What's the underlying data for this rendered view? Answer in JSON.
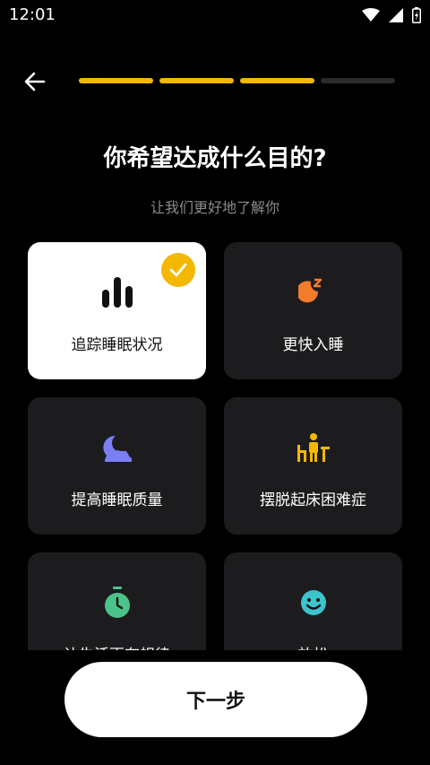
{
  "status_bar": {
    "time": "12:01"
  },
  "progress": {
    "total_steps": 4,
    "completed_steps": 3,
    "accent_color": "#f5b800"
  },
  "header": {
    "title": "你希望达成什么目的?",
    "subtitle": "让我们更好地了解你"
  },
  "options": [
    {
      "label": "追踪睡眠状况",
      "icon": "bar-chart-icon",
      "selected": true
    },
    {
      "label": "更快入睡",
      "icon": "moon-zz-icon",
      "selected": false
    },
    {
      "label": "提高睡眠质量",
      "icon": "moon-cloud-icon",
      "selected": false
    },
    {
      "label": "摆脱起床困难症",
      "icon": "person-desk-icon",
      "selected": false
    },
    {
      "label": "让生活更有规律",
      "icon": "stopwatch-icon",
      "selected": false
    },
    {
      "label": "放松",
      "icon": "smile-icon",
      "selected": false
    }
  ],
  "next_button": {
    "label": "下一步"
  }
}
